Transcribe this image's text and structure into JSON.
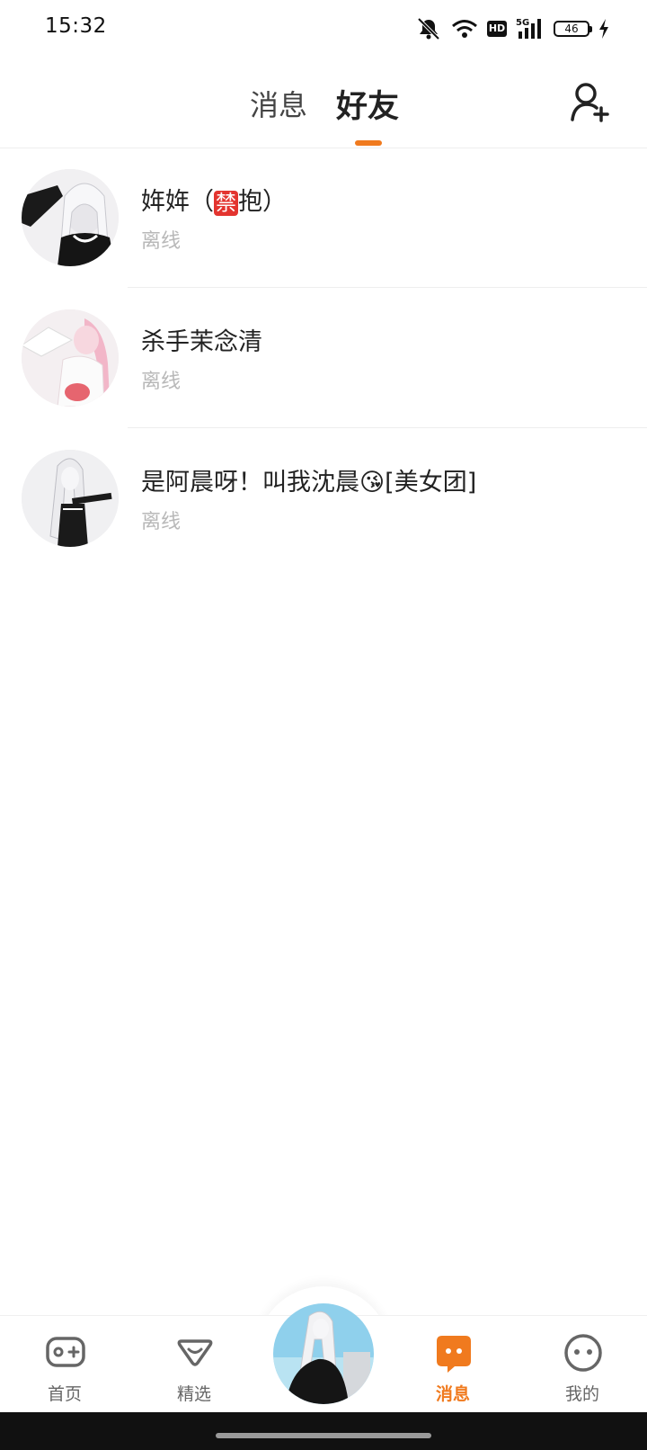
{
  "status_bar": {
    "time": "15:32",
    "network_badge": "HD",
    "signal_label": "5G",
    "battery_level": "46"
  },
  "header": {
    "tabs": [
      {
        "label": "消息",
        "active": false
      },
      {
        "label": "好友",
        "active": true
      }
    ],
    "add_friend_icon": "add-person-icon",
    "accent_color": "#f07a1e"
  },
  "friends": [
    {
      "name_prefix": "姩姩（",
      "badge": "禁",
      "name_suffix": "抱）",
      "status": "离线"
    },
    {
      "name": "杀手茉念清",
      "status": "离线"
    },
    {
      "name": "是阿晨呀！叫我沈晨",
      "emoji": "😘",
      "name_suffix": "[美女团]",
      "status": "离线"
    }
  ],
  "bottom_nav": {
    "items": [
      {
        "label": "首页",
        "icon": "gamepad-icon",
        "active": false
      },
      {
        "label": "精选",
        "icon": "heart-icon",
        "active": false
      },
      {
        "label": "消息",
        "icon": "chat-icon",
        "active": true
      },
      {
        "label": "我的",
        "icon": "face-icon",
        "active": false
      }
    ],
    "center_icon": "avatar"
  }
}
